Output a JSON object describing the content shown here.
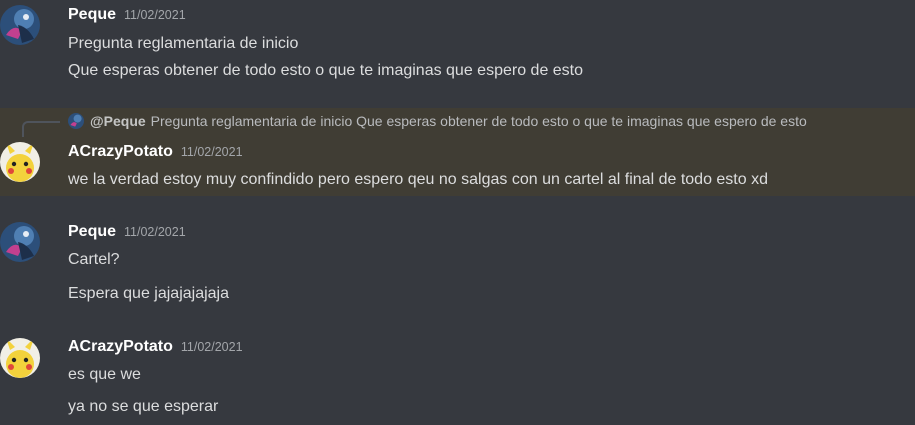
{
  "messages": [
    {
      "author": "Peque",
      "timestamp": "11/02/2021",
      "avatar_icon": "bird-avatar-icon",
      "lines": [
        "Pregunta reglamentaria de inicio",
        "Que esperas obtener de todo esto o que te imaginas que espero de esto"
      ]
    },
    {
      "author": "ACrazyPotato",
      "timestamp": "11/02/2021",
      "avatar_icon": "pikachu-avatar-icon",
      "highlighted": true,
      "reply": {
        "mention": "@Peque",
        "text": "Pregunta reglamentaria de inicio Que esperas obtener de todo esto o que te imaginas que espero de esto"
      },
      "lines": [
        "we la verdad estoy muy confindido pero espero qeu no salgas con un cartel al final de todo esto xd"
      ]
    },
    {
      "author": "Peque",
      "timestamp": "11/02/2021",
      "avatar_icon": "bird-avatar-icon",
      "lines": [
        "Cartel?",
        "Espera que jajajajajaja"
      ]
    },
    {
      "author": "ACrazyPotato",
      "timestamp": "11/02/2021",
      "avatar_icon": "pikachu-avatar-icon",
      "lines": [
        "es que we",
        "ya no se que esperar"
      ]
    }
  ],
  "colors": {
    "background": "#36393f",
    "highlight": "#403d34",
    "username": "#ffffff",
    "timestamp": "#a3a6aa",
    "text": "#dcddde"
  }
}
